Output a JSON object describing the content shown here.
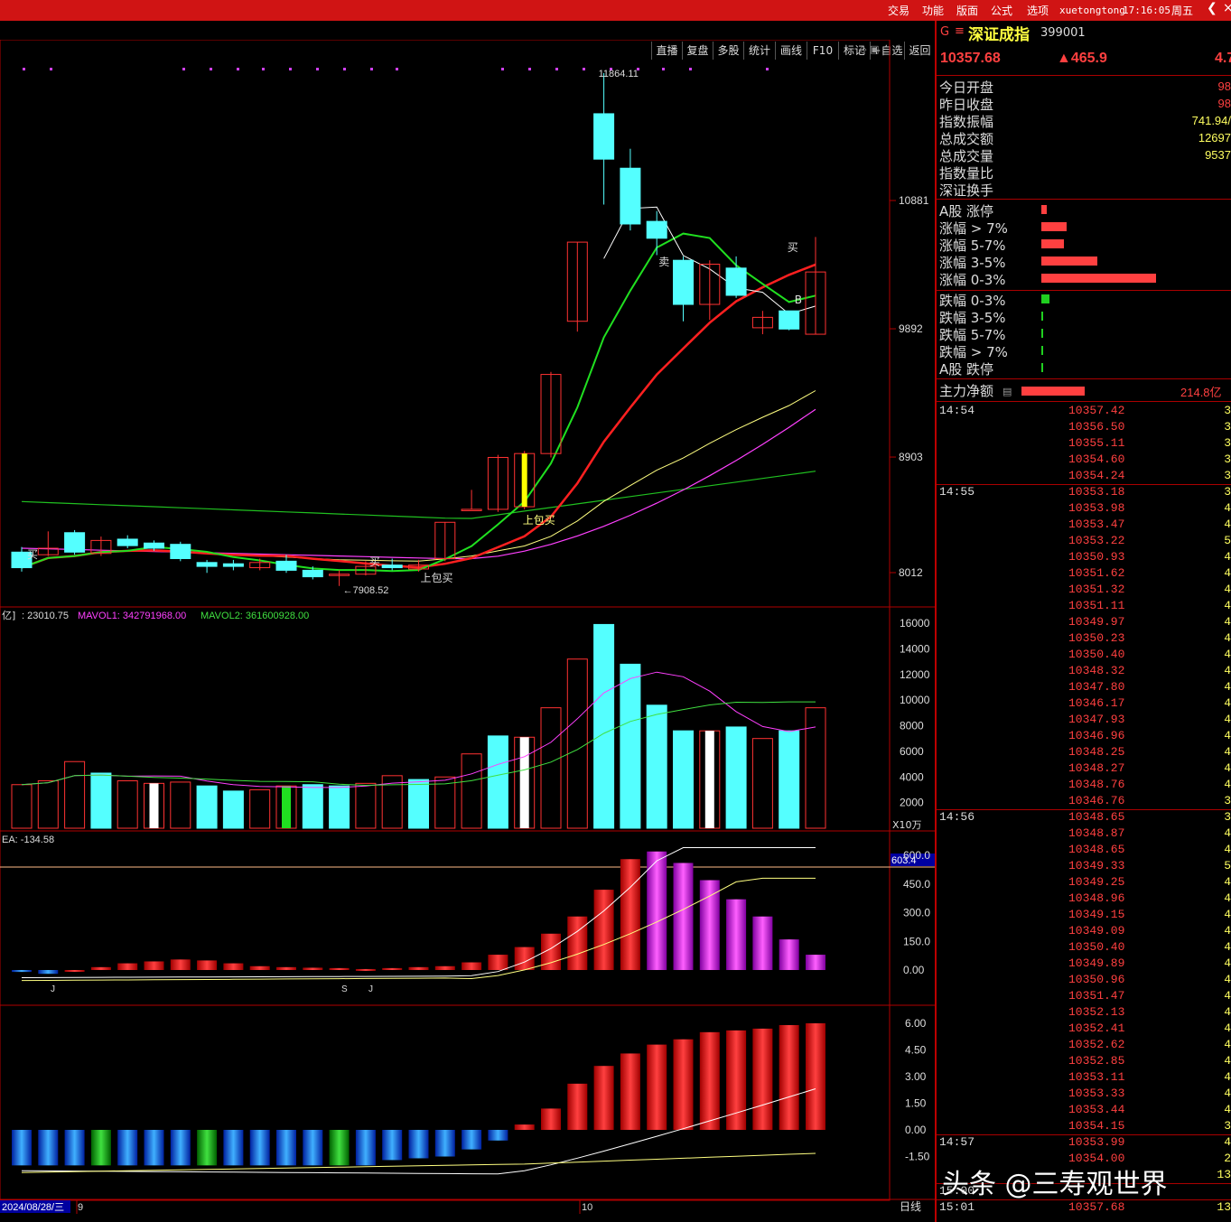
{
  "menu": {
    "items": [
      "交易",
      "功能",
      "版面",
      "公式",
      "选项"
    ],
    "user": "xuetongtong",
    "clock": "17:16:05",
    "weekday": "周五",
    "back_icon": "chevron-left-icon",
    "close_icon": "close-icon"
  },
  "toolbar": [
    "直播",
    "复盘",
    "多股",
    "统计",
    "画线",
    "F10",
    "标记",
    "+自选",
    "返回"
  ],
  "stock": {
    "mark": "G",
    "menu_icon": "hamburger-icon",
    "name": "深证成指",
    "code": "399001",
    "price": "10357.68",
    "change": "▲465.9",
    "change_pct": "4.7"
  },
  "stats": [
    {
      "label": "今日开盘",
      "value": "98"
    },
    {
      "label": "昨日收盘",
      "value": "98"
    },
    {
      "label": "指数振幅",
      "value": "741.94/"
    },
    {
      "label": "总成交额",
      "value": "12697"
    },
    {
      "label": "总成交量",
      "value": "9537"
    },
    {
      "label": "指数量比",
      "value": ""
    },
    {
      "label": "深证换手",
      "value": ""
    }
  ],
  "breadth_up": [
    {
      "label": "A股 涨停",
      "bar": 0.05
    },
    {
      "label": "涨幅 > 7%",
      "bar": 0.22
    },
    {
      "label": "涨幅 5-7%",
      "bar": 0.2
    },
    {
      "label": "涨幅 3-5%",
      "bar": 0.49
    },
    {
      "label": "涨幅 0-3%",
      "bar": 1.0
    }
  ],
  "breadth_down": [
    {
      "label": "跌幅 0-3%",
      "bar": 0.07
    },
    {
      "label": "跌幅 3-5%",
      "bar": 0.01
    },
    {
      "label": "跌幅 5-7%",
      "bar": 0.01
    },
    {
      "label": "跌幅 > 7%",
      "bar": 0.01
    },
    {
      "label": "A股 跌停",
      "bar": 0.01
    }
  ],
  "main_force": {
    "label": "主力净额",
    "value": "214.8亿",
    "bar": 0.55
  },
  "ticks": [
    {
      "time": "14:54",
      "price": "10357.42",
      "vol": "3"
    },
    {
      "time": "",
      "price": "10356.50",
      "vol": "3"
    },
    {
      "time": "",
      "price": "10355.11",
      "vol": "3"
    },
    {
      "time": "",
      "price": "10354.60",
      "vol": "3"
    },
    {
      "time": "",
      "price": "10354.24",
      "vol": "3"
    },
    {
      "time": "14:55",
      "price": "10353.18",
      "vol": "3"
    },
    {
      "time": "",
      "price": "10353.98",
      "vol": "4"
    },
    {
      "time": "",
      "price": "10353.47",
      "vol": "4"
    },
    {
      "time": "",
      "price": "10353.22",
      "vol": "5"
    },
    {
      "time": "",
      "price": "10350.93",
      "vol": "4"
    },
    {
      "time": "",
      "price": "10351.62",
      "vol": "4"
    },
    {
      "time": "",
      "price": "10351.32",
      "vol": "4"
    },
    {
      "time": "",
      "price": "10351.11",
      "vol": "4"
    },
    {
      "time": "",
      "price": "10349.97",
      "vol": "4"
    },
    {
      "time": "",
      "price": "10350.23",
      "vol": "4"
    },
    {
      "time": "",
      "price": "10350.40",
      "vol": "4"
    },
    {
      "time": "",
      "price": "10348.32",
      "vol": "4"
    },
    {
      "time": "",
      "price": "10347.80",
      "vol": "4"
    },
    {
      "time": "",
      "price": "10346.17",
      "vol": "4"
    },
    {
      "time": "",
      "price": "10347.93",
      "vol": "4"
    },
    {
      "time": "",
      "price": "10346.96",
      "vol": "4"
    },
    {
      "time": "",
      "price": "10348.25",
      "vol": "4"
    },
    {
      "time": "",
      "price": "10348.27",
      "vol": "4"
    },
    {
      "time": "",
      "price": "10348.76",
      "vol": "4"
    },
    {
      "time": "",
      "price": "10346.76",
      "vol": "3"
    },
    {
      "time": "14:56",
      "price": "10348.65",
      "vol": "3"
    },
    {
      "time": "",
      "price": "10348.87",
      "vol": "4"
    },
    {
      "time": "",
      "price": "10348.65",
      "vol": "4"
    },
    {
      "time": "",
      "price": "10349.33",
      "vol": "5"
    },
    {
      "time": "",
      "price": "10349.25",
      "vol": "4"
    },
    {
      "time": "",
      "price": "10348.96",
      "vol": "4"
    },
    {
      "time": "",
      "price": "10349.15",
      "vol": "4"
    },
    {
      "time": "",
      "price": "10349.09",
      "vol": "4"
    },
    {
      "time": "",
      "price": "10350.40",
      "vol": "4"
    },
    {
      "time": "",
      "price": "10349.89",
      "vol": "4"
    },
    {
      "time": "",
      "price": "10350.96",
      "vol": "4"
    },
    {
      "time": "",
      "price": "10351.47",
      "vol": "4"
    },
    {
      "time": "",
      "price": "10352.13",
      "vol": "4"
    },
    {
      "time": "",
      "price": "10352.41",
      "vol": "4"
    },
    {
      "time": "",
      "price": "10352.62",
      "vol": "4"
    },
    {
      "time": "",
      "price": "10352.85",
      "vol": "4"
    },
    {
      "time": "",
      "price": "10353.11",
      "vol": "4"
    },
    {
      "time": "",
      "price": "10353.33",
      "vol": "4"
    },
    {
      "time": "",
      "price": "10353.44",
      "vol": "4"
    },
    {
      "time": "",
      "price": "10354.15",
      "vol": "3"
    },
    {
      "time": "14:57",
      "price": "10353.99",
      "vol": "4"
    },
    {
      "time": "",
      "price": "10354.00",
      "vol": "2"
    },
    {
      "time": "",
      "price": "",
      "vol": "13"
    },
    {
      "time": "15:00",
      "price": "",
      "vol": ""
    },
    {
      "time": "15:01",
      "price": "10357.68",
      "vol": "13"
    }
  ],
  "watermark": "头条 @三寿观世界",
  "chart": {
    "high_label": "11864.11",
    "low_label": "←7908.52",
    "price_axis": [
      "10881",
      "9892",
      "8903",
      "8012"
    ],
    "signals": [
      {
        "text": "买",
        "idx": 0
      },
      {
        "text": "买",
        "idx": 13
      },
      {
        "text": "上包买",
        "idx": 15
      },
      {
        "text": "上包买",
        "idx": 19
      },
      {
        "text": "卖",
        "idx": 24
      },
      {
        "text": "买",
        "idx": 29
      },
      {
        "text": "B",
        "idx": 29
      }
    ],
    "vol_header": {
      "name": "亿]",
      "value": ": 23010.75",
      "ma1_label": "MAVOL1: 342791968.00",
      "ma2_label": "MAVOL2: 361600928.00"
    },
    "vol_axis": [
      "16000",
      "14000",
      "12000",
      "10000",
      "8000",
      "6000",
      "4000",
      "2000"
    ],
    "vol_unit": "X10万",
    "macd_header": "EA: -134.58",
    "macd_marker": "603.4",
    "macd_axis": [
      "600.0",
      "450.0",
      "300.0",
      "150.0",
      "0.00"
    ],
    "macd_letters": [
      "J",
      "S",
      "J"
    ],
    "osc_axis": [
      "6.00",
      "4.50",
      "3.00",
      "1.50",
      "0.00",
      "-1.50"
    ],
    "date_label": "2024/08/28/三",
    "month_labels": [
      "9",
      "10"
    ],
    "period": "日线"
  },
  "chart_data": {
    "type": "candlestick",
    "colors": {
      "up": "#ff3232",
      "down": "#54ffff",
      "ma5": "#ffffff",
      "ma10": "#ff2020",
      "ma20": "#ffff80",
      "ma60": "#ff40ff",
      "ma120": "#20c020"
    },
    "candles": [
      {
        "o": 8170,
        "c": 8050,
        "h": 8210,
        "l": 8020
      },
      {
        "o": 8150,
        "c": 8200,
        "h": 8330,
        "l": 8140
      },
      {
        "o": 8320,
        "c": 8170,
        "h": 8340,
        "l": 8150
      },
      {
        "o": 8160,
        "c": 8260,
        "h": 8290,
        "l": 8140
      },
      {
        "o": 8270,
        "c": 8220,
        "h": 8300,
        "l": 8200
      },
      {
        "o": 8240,
        "c": 8200,
        "h": 8260,
        "l": 8180
      },
      {
        "o": 8230,
        "c": 8120,
        "h": 8250,
        "l": 8100
      },
      {
        "o": 8090,
        "c": 8060,
        "h": 8110,
        "l": 8010
      },
      {
        "o": 8080,
        "c": 8060,
        "h": 8110,
        "l": 8030
      },
      {
        "o": 8050,
        "c": 8090,
        "h": 8120,
        "l": 8030
      },
      {
        "o": 8100,
        "c": 8030,
        "h": 8150,
        "l": 8010
      },
      {
        "o": 8030,
        "c": 7980,
        "h": 8060,
        "l": 7960
      },
      {
        "o": 8000,
        "c": 8000,
        "h": 8030,
        "l": 7909
      },
      {
        "o": 8000,
        "c": 8060,
        "h": 8100,
        "l": 7990
      },
      {
        "o": 8070,
        "c": 8050,
        "h": 8120,
        "l": 8030
      },
      {
        "o": 8040,
        "c": 8070,
        "h": 8110,
        "l": 8020
      },
      {
        "o": 8120,
        "c": 8400,
        "h": 8400,
        "l": 8100
      },
      {
        "o": 8500,
        "c": 8500,
        "h": 8650,
        "l": 8500
      },
      {
        "o": 8500,
        "c": 8900,
        "h": 8920,
        "l": 8480
      },
      {
        "o": 8520,
        "c": 8930,
        "h": 8950,
        "l": 8500
      },
      {
        "o": 8930,
        "c": 9540,
        "h": 9560,
        "l": 8900
      },
      {
        "o": 9950,
        "c": 10560,
        "h": 10560,
        "l": 9870
      },
      {
        "o": 11550,
        "c": 11200,
        "h": 11864,
        "l": 10850
      },
      {
        "o": 11130,
        "c": 10700,
        "h": 11280,
        "l": 10650
      },
      {
        "o": 10720,
        "c": 10590,
        "h": 10800,
        "l": 10460
      },
      {
        "o": 10420,
        "c": 10080,
        "h": 10450,
        "l": 9950
      },
      {
        "o": 10080,
        "c": 10390,
        "h": 10420,
        "l": 9960
      },
      {
        "o": 10360,
        "c": 10150,
        "h": 10450,
        "l": 10130
      },
      {
        "o": 9900,
        "c": 9980,
        "h": 10030,
        "l": 9850
      },
      {
        "o": 10030,
        "c": 9890,
        "h": 10030,
        "l": 9880
      },
      {
        "o": 9850,
        "c": 10330,
        "h": 10600,
        "l": 9850
      }
    ],
    "volume": [
      3400,
      3700,
      5200,
      4300,
      3700,
      3500,
      3600,
      3300,
      2900,
      3000,
      3300,
      3400,
      3300,
      3500,
      4100,
      3800,
      4000,
      5800,
      7200,
      7100,
      9400,
      13200,
      15900,
      12800,
      9600,
      7600,
      7600,
      7900,
      7000,
      7600,
      9400
    ],
    "volume_colors": [
      "up",
      "up",
      "up",
      "down",
      "up",
      "white",
      "up",
      "down",
      "down",
      "up",
      "green",
      "down",
      "down",
      "up",
      "up",
      "down",
      "up",
      "up",
      "down",
      "white",
      "up",
      "up",
      "down",
      "down",
      "down",
      "down",
      "white",
      "down",
      "up",
      "down",
      "up"
    ],
    "macd": [
      -10,
      -20,
      0,
      15,
      35,
      45,
      55,
      50,
      35,
      20,
      15,
      12,
      10,
      5,
      10,
      15,
      20,
      40,
      80,
      120,
      190,
      280,
      420,
      580,
      620,
      560,
      470,
      370,
      280,
      160,
      80
    ],
    "osc": [
      -2,
      -2,
      -2,
      -2,
      -2,
      -2,
      -2,
      -2,
      -2,
      -2,
      -2,
      -2,
      -2,
      -2,
      -1.7,
      -1.6,
      -1.5,
      -1.1,
      -0.6,
      0.3,
      1.2,
      2.6,
      3.6,
      4.3,
      4.8,
      5.1,
      5.5,
      5.6,
      5.7,
      5.9,
      6.0
    ]
  }
}
